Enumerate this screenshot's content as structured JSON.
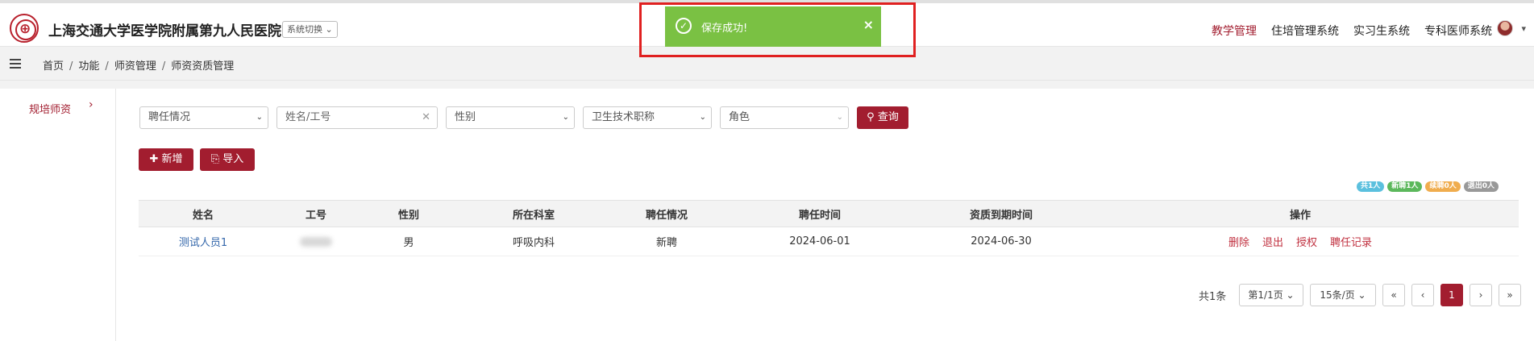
{
  "header": {
    "hospital_name": "上海交通大学医学院附属第九人民医院",
    "system_switch": "系统切换",
    "nav": [
      "教学管理",
      "住培管理系统",
      "实习生系统",
      "专科医师系统"
    ],
    "active_nav": "教学管理"
  },
  "breadcrumb": [
    "首页",
    "功能",
    "师资管理",
    "师资资质管理"
  ],
  "sidebar": {
    "items": [
      {
        "label": "规培师资"
      }
    ]
  },
  "toast": {
    "message": "保存成功!",
    "close": "×"
  },
  "filters": {
    "employment": "聘任情况",
    "name_placeholder": "姓名/工号",
    "gender": "性别",
    "title": "卫生技术职称",
    "role": "角色",
    "query_button": "查询"
  },
  "actions": {
    "add": "新增",
    "import": "导入"
  },
  "badges": [
    {
      "label": "共1人",
      "color": "#5bc0de"
    },
    {
      "label": "新聘1人",
      "color": "#5cb85c"
    },
    {
      "label": "续聘0人",
      "color": "#f0ad4e"
    },
    {
      "label": "退出0人",
      "color": "#999999"
    }
  ],
  "table": {
    "columns": [
      "姓名",
      "工号",
      "性别",
      "所在科室",
      "聘任情况",
      "聘任时间",
      "资质到期时间",
      "操作"
    ],
    "rows": [
      {
        "name": "测试人员1",
        "gender": "男",
        "department": "呼吸内科",
        "status": "新聘",
        "hire_date": "2024-06-01",
        "expire_date": "2024-06-30",
        "ops": [
          "删除",
          "退出",
          "授权",
          "聘任记录"
        ]
      }
    ]
  },
  "pagination": {
    "total": "共1条",
    "page": "第1/1页",
    "page_size": "15条/页",
    "first": "«",
    "prev": "‹",
    "current": "1",
    "next": "›",
    "last": "»"
  },
  "colors": {
    "brand": "#a21d2f",
    "toast": "#7ac143",
    "highlight_frame": "#e02020"
  }
}
